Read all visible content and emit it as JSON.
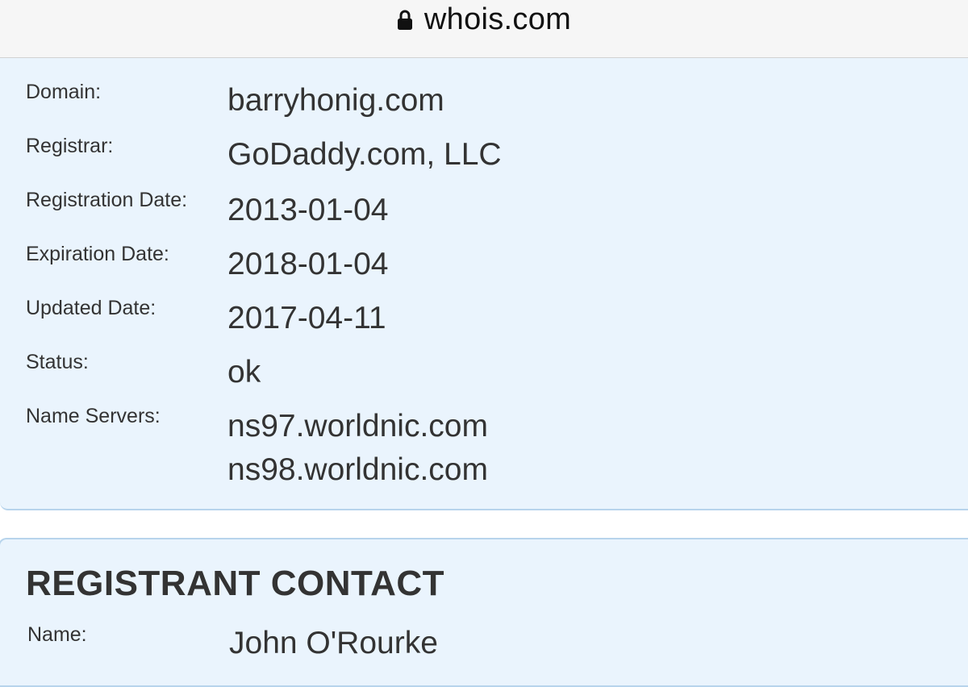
{
  "browser": {
    "url": "whois.com",
    "lock_icon": "lock-icon"
  },
  "domain_info": {
    "rows": [
      {
        "label": "Domain:",
        "value": "barryhonig.com"
      },
      {
        "label": "Registrar:",
        "value": "GoDaddy.com, LLC"
      },
      {
        "label": "Registration Date:",
        "value": "2013-01-04"
      },
      {
        "label": "Expiration Date:",
        "value": "2018-01-04"
      },
      {
        "label": "Updated Date:",
        "value": "2017-04-11"
      },
      {
        "label": "Status:",
        "value": "ok"
      },
      {
        "label": "Name Servers:",
        "values": [
          "ns97.worldnic.com",
          "ns98.worldnic.com"
        ]
      }
    ]
  },
  "registrant_contact": {
    "title": "REGISTRANT CONTACT",
    "rows": [
      {
        "label": "Name:",
        "value": "John O'Rourke"
      }
    ]
  },
  "colors": {
    "panel_background": "#eaf4fd",
    "panel_border": "#b7d4ec",
    "text": "#333333"
  }
}
